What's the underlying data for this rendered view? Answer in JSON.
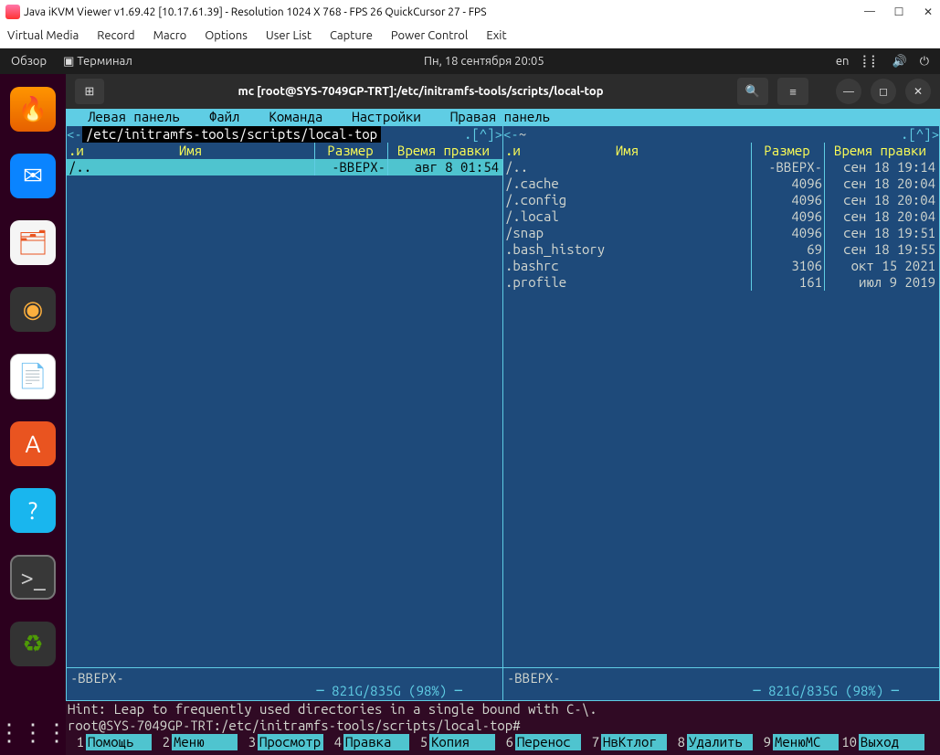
{
  "window": {
    "title": "Java iKVM Viewer v1.69.42 [10.17.61.39]  - Resolution 1024 X 768 - FPS 26 QuickCursor 27 - FPS"
  },
  "kvm_menu": [
    "Virtual Media",
    "Record",
    "Macro",
    "Options",
    "User List",
    "Capture",
    "Power Control",
    "Exit"
  ],
  "topbar": {
    "overview": "Обзор",
    "terminal": "Терминал",
    "clock": "Пн, 18 сентября  20:05",
    "lang": "en"
  },
  "term_window": {
    "title": "mc [root@SYS-7049GP-TRT]:/etc/initramfs-tools/scripts/local-top"
  },
  "mc_menu": [
    "Левая панель",
    "Файл",
    "Команда",
    "Настройки",
    "Правая панель"
  ],
  "left_panel": {
    "path": "/etc/initramfs-tools/scripts/local-top",
    "indicator": ".[^]",
    "corner": ".и",
    "headers": {
      "name": "Имя",
      "size": "Размер",
      "date": "Время правки"
    },
    "rows": [
      {
        "name": "/..",
        "size": "-ВВЕРХ-",
        "date": "авг  8 01:54",
        "sel": true
      }
    ],
    "footer": "-ВВЕРХ-",
    "usage": "821G/835G (98%)"
  },
  "right_panel": {
    "path": "~",
    "indicator": ".[^]",
    "corner": ".и",
    "headers": {
      "name": "Имя",
      "size": "Размер",
      "date": "Время правки"
    },
    "rows": [
      {
        "name": "/..",
        "size": "-ВВЕРХ-",
        "date": "сен 18 19:14"
      },
      {
        "name": "/.cache",
        "size": "4096",
        "date": "сен 18 20:04"
      },
      {
        "name": "/.config",
        "size": "4096",
        "date": "сен 18 20:04"
      },
      {
        "name": "/.local",
        "size": "4096",
        "date": "сен 18 20:04"
      },
      {
        "name": "/snap",
        "size": "4096",
        "date": "сен 18 19:51"
      },
      {
        "name": " .bash_history",
        "size": "69",
        "date": "сен 18 19:55"
      },
      {
        "name": " .bashrc",
        "size": "3106",
        "date": "окт 15  2021"
      },
      {
        "name": " .profile",
        "size": "161",
        "date": "июл  9  2019"
      }
    ],
    "footer": "-ВВЕРХ-",
    "usage": "821G/835G (98%)"
  },
  "hint": "Hint: Leap to frequently used directories in a single bound with C-\\.",
  "prompt": "root@SYS-7049GP-TRT:/etc/initramfs-tools/scripts/local-top#",
  "fkeys": [
    {
      "n": "1",
      "l": "Помощь"
    },
    {
      "n": "2",
      "l": "Меню"
    },
    {
      "n": "3",
      "l": "Просмотр"
    },
    {
      "n": "4",
      "l": "Правка"
    },
    {
      "n": "5",
      "l": "Копия"
    },
    {
      "n": "6",
      "l": "Перенос"
    },
    {
      "n": "7",
      "l": "НвКтлог"
    },
    {
      "n": "8",
      "l": "Удалить"
    },
    {
      "n": "9",
      "l": "МенюМС"
    },
    {
      "n": "10",
      "l": "Выход"
    }
  ]
}
